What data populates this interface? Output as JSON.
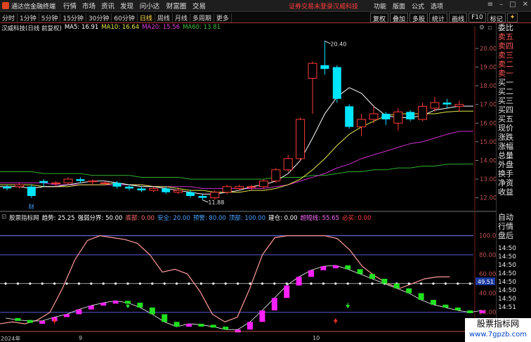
{
  "menubar": {
    "app_title": "通达信金融终端",
    "items": [
      "行情",
      "市场",
      "资讯",
      "发现",
      "问小达",
      "财富圈",
      "交易"
    ],
    "alert_text": "证券交易未登录",
    "stock_name": "汉威科技",
    "right_items": [
      "功能",
      "版面",
      "公式",
      "选项"
    ]
  },
  "periodbar": {
    "periods": [
      "分时",
      "1分钟",
      "5分钟",
      "15分钟",
      "30分钟",
      "60分钟",
      "日线",
      "周线",
      "月线",
      "多周期",
      "更多"
    ],
    "active_period": "日线",
    "tools": [
      "复权",
      "叠加",
      "多股",
      "统计",
      "画线",
      "F10",
      "标记"
    ]
  },
  "main_chart": {
    "title": "汉威科技(日线 前复权)",
    "ma_labels": [
      {
        "text": "MA5: 16.91",
        "color": "#ffffff"
      },
      {
        "text": "MA10: 16.64",
        "color": "#e6e84a"
      },
      {
        "text": "MA20: 15.56",
        "color": "#e040e0"
      },
      {
        "text": "MA60: 13.81",
        "color": "#40c040"
      }
    ],
    "price_ticks": [
      "20.00",
      "19.00",
      "18.00",
      "17.00",
      "16.00",
      "15.00",
      "14.00",
      "13.00",
      "12.00"
    ],
    "high_label": "20.40",
    "low_label": "11.88",
    "finance_marker": "财"
  },
  "chart_data": [
    {
      "type": "candlestick",
      "title": "汉威科技(日线 前复权)",
      "ylim": [
        11.5,
        20.9
      ],
      "candles": [
        {
          "o": 12.6,
          "c": 12.5,
          "h": 12.7,
          "l": 12.4
        },
        {
          "o": 12.6,
          "c": 12.7,
          "h": 12.8,
          "l": 12.5
        },
        {
          "o": 12.6,
          "c": 12.1,
          "h": 12.7,
          "l": 12.0
        },
        {
          "o": 12.9,
          "c": 12.8,
          "h": 13.0,
          "l": 12.6
        },
        {
          "o": 12.8,
          "c": 12.8,
          "h": 12.9,
          "l": 12.6
        },
        {
          "o": 12.8,
          "c": 13.0,
          "h": 13.1,
          "l": 12.7
        },
        {
          "o": 13.0,
          "c": 12.9,
          "h": 13.1,
          "l": 12.8
        },
        {
          "o": 12.9,
          "c": 12.9,
          "h": 13.0,
          "l": 12.7
        },
        {
          "o": 12.8,
          "c": 12.8,
          "h": 12.9,
          "l": 12.7
        },
        {
          "o": 12.8,
          "c": 12.6,
          "h": 12.9,
          "l": 12.5
        },
        {
          "o": 12.6,
          "c": 12.5,
          "h": 12.7,
          "l": 12.4
        },
        {
          "o": 12.5,
          "c": 12.4,
          "h": 12.6,
          "l": 12.3
        },
        {
          "o": 12.4,
          "c": 12.5,
          "h": 12.6,
          "l": 12.3
        },
        {
          "o": 12.5,
          "c": 12.3,
          "h": 12.6,
          "l": 12.2
        },
        {
          "o": 12.3,
          "c": 12.4,
          "h": 12.5,
          "l": 12.2
        },
        {
          "o": 12.3,
          "c": 12.1,
          "h": 12.4,
          "l": 12.0
        },
        {
          "o": 12.1,
          "c": 12.0,
          "h": 12.2,
          "l": 11.88
        },
        {
          "o": 12.0,
          "c": 12.3,
          "h": 12.4,
          "l": 11.9
        },
        {
          "o": 12.3,
          "c": 12.6,
          "h": 12.7,
          "l": 12.2
        },
        {
          "o": 12.5,
          "c": 12.6,
          "h": 12.7,
          "l": 12.4
        },
        {
          "o": 12.6,
          "c": 12.6,
          "h": 12.7,
          "l": 12.4
        },
        {
          "o": 12.6,
          "c": 12.9,
          "h": 13.0,
          "l": 12.5
        },
        {
          "o": 12.9,
          "c": 13.5,
          "h": 13.6,
          "l": 12.8
        },
        {
          "o": 13.5,
          "c": 14.1,
          "h": 14.3,
          "l": 13.4
        },
        {
          "o": 14.1,
          "c": 16.2,
          "h": 16.3,
          "l": 14.0
        },
        {
          "o": 18.4,
          "c": 19.2,
          "h": 19.3,
          "l": 16.5
        },
        {
          "o": 19.1,
          "c": 18.9,
          "h": 20.4,
          "l": 18.6
        },
        {
          "o": 19.0,
          "c": 17.3,
          "h": 19.1,
          "l": 17.1
        },
        {
          "o": 16.9,
          "c": 15.8,
          "h": 17.0,
          "l": 15.7
        },
        {
          "o": 15.8,
          "c": 16.2,
          "h": 16.5,
          "l": 15.3
        },
        {
          "o": 16.2,
          "c": 16.5,
          "h": 16.9,
          "l": 16.0
        },
        {
          "o": 16.5,
          "c": 16.2,
          "h": 16.6,
          "l": 15.9
        },
        {
          "o": 16.0,
          "c": 16.6,
          "h": 16.8,
          "l": 15.6
        },
        {
          "o": 16.6,
          "c": 16.2,
          "h": 16.7,
          "l": 16.1
        },
        {
          "o": 16.2,
          "c": 16.9,
          "h": 17.1,
          "l": 16.1
        },
        {
          "o": 16.8,
          "c": 17.1,
          "h": 17.4,
          "l": 16.6
        },
        {
          "o": 17.1,
          "c": 17.0,
          "h": 17.3,
          "l": 16.8
        },
        {
          "o": 16.9,
          "c": 17.0,
          "h": 17.2,
          "l": 16.6
        }
      ],
      "ma5": [
        12.6,
        12.6,
        12.5,
        12.6,
        12.6,
        12.7,
        12.8,
        12.9,
        12.9,
        12.8,
        12.7,
        12.6,
        12.6,
        12.5,
        12.4,
        12.3,
        12.2,
        12.2,
        12.3,
        12.4,
        12.6,
        12.7,
        12.9,
        13.3,
        14.0,
        15.2,
        16.5,
        17.4,
        17.9,
        17.6,
        16.9,
        16.4,
        16.3,
        16.3,
        16.4,
        16.7,
        16.8,
        16.91
      ],
      "ma10": [
        12.7,
        12.7,
        12.7,
        12.6,
        12.6,
        12.6,
        12.7,
        12.7,
        12.7,
        12.8,
        12.7,
        12.7,
        12.6,
        12.6,
        12.5,
        12.4,
        12.4,
        12.3,
        12.3,
        12.3,
        12.4,
        12.4,
        12.5,
        12.7,
        13.0,
        13.5,
        14.1,
        14.8,
        15.4,
        15.8,
        16.1,
        16.4,
        16.5,
        16.5,
        16.5,
        16.5,
        16.6,
        16.64
      ],
      "ma20": [
        12.8,
        12.8,
        12.8,
        12.8,
        12.7,
        12.7,
        12.7,
        12.7,
        12.7,
        12.7,
        12.7,
        12.7,
        12.6,
        12.6,
        12.6,
        12.6,
        12.5,
        12.5,
        12.5,
        12.5,
        12.5,
        12.5,
        12.6,
        12.7,
        12.9,
        13.1,
        13.3,
        13.6,
        13.8,
        14.1,
        14.3,
        14.5,
        14.7,
        14.9,
        15.0,
        15.2,
        15.4,
        15.56
      ],
      "ma60": [
        13.4,
        13.4,
        13.4,
        13.3,
        13.3,
        13.3,
        13.3,
        13.2,
        13.2,
        13.2,
        13.2,
        13.1,
        13.1,
        13.1,
        13.1,
        13.0,
        13.0,
        13.0,
        13.0,
        13.0,
        13.0,
        13.0,
        13.1,
        13.1,
        13.1,
        13.2,
        13.2,
        13.3,
        13.4,
        13.4,
        13.5,
        13.5,
        13.6,
        13.6,
        13.7,
        13.7,
        13.8,
        13.81
      ]
    },
    {
      "type": "line",
      "title": "股票指标网",
      "ylim": [
        0,
        110
      ],
      "levels": [
        100,
        80,
        50,
        20
      ],
      "trend_line": [
        8,
        10,
        8,
        12,
        20,
        45,
        75,
        95,
        100,
        98,
        96,
        92,
        80,
        62,
        65,
        60,
        42,
        18,
        10,
        15,
        45,
        80,
        98,
        100,
        100,
        100,
        100,
        97,
        85,
        68,
        58,
        50,
        45,
        50,
        55,
        57,
        57
      ],
      "strength": [
        14,
        12,
        11,
        11,
        15,
        18,
        23,
        27,
        30,
        32,
        30,
        25,
        18,
        10,
        5,
        8,
        7,
        5,
        2,
        2,
        10,
        22,
        35,
        48,
        57,
        64,
        68,
        69,
        65,
        60,
        55,
        50,
        45,
        40,
        33,
        28,
        25,
        22,
        20,
        22
      ],
      "up_arrows_at": [
        4,
        27
      ],
      "down_arrows_at": [
        10,
        28
      ]
    }
  ],
  "sub_chart": {
    "title": "股票指标网",
    "labels": [
      {
        "text": "趋势: 25.25",
        "color": "#ffffff"
      },
      {
        "text": "强弱分界: 50.00",
        "color": "#ffffff"
      },
      {
        "text": "底部: 0.00",
        "color": "#ff7070"
      },
      {
        "text": "安全: 20.00",
        "color": "#4aa0ff"
      },
      {
        "text": "预警: 80.00",
        "color": "#4aa0ff"
      },
      {
        "text": "顶部: 100.00",
        "color": "#4aa0ff"
      },
      {
        "text": "建仓: 0.00",
        "color": "#ffffff"
      },
      {
        "text": "超短线: 55.65",
        "color": "#ff70ff"
      },
      {
        "text": "必买: 0.00",
        "color": "#ff4040"
      }
    ],
    "level_ticks": [
      "100.0",
      "80.00",
      "60.00",
      "40.00",
      "20.00"
    ],
    "value_tag": "49.51"
  },
  "time_axis": {
    "labels": [
      "2024年",
      "9",
      "10"
    ]
  },
  "rightcol": {
    "quote_labels": [
      "委比",
      "卖五",
      "卖四",
      "卖三",
      "卖二",
      "卖一",
      "买一",
      "买二",
      "买三",
      "买四",
      "买五",
      "现价",
      "涨跌",
      "涨幅",
      "总量",
      "外盘",
      "换手",
      "净资",
      "收益"
    ],
    "lower_labels": [
      "自动",
      "行情",
      "盘后"
    ],
    "times": [
      "14:50",
      "14:50",
      "14:50",
      "14:50",
      "14:50",
      "14:50",
      "14:50",
      "14:51"
    ]
  },
  "watermark": {
    "line1": "股票指标网",
    "line2": "www.7gpzb.com"
  },
  "colors": {
    "up": "#ff3b3b",
    "down": "#00e5ff",
    "ma5": "#ffffff",
    "ma10": "#e6e84a",
    "ma20": "#d030d0",
    "ma60": "#30b030",
    "trend_line": "#ff9a9a",
    "strength_up": "#ff20ff",
    "strength_down": "#20e020"
  }
}
